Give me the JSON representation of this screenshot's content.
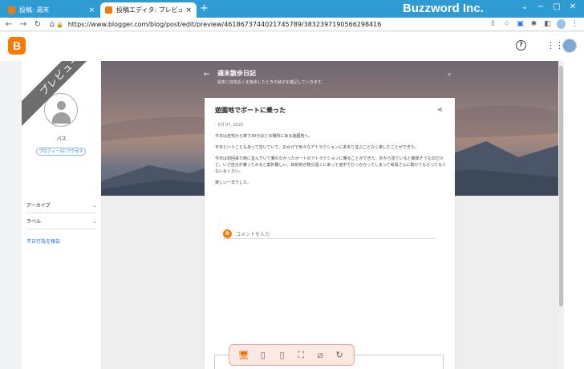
{
  "browser": {
    "tabs": [
      {
        "title": "投稿: 週末"
      },
      {
        "title": "投稿エディタ: プレビュー"
      }
    ],
    "tab_close": "×",
    "new_tab": "+",
    "brand": "Buzzword Inc.",
    "url": "https://www.blogger.com/blog/post/edit/preview/4618673744021745789/3832397190566298416",
    "window_controls": [
      "⌄",
      "−",
      "□",
      "✕"
    ],
    "nav": [
      "←",
      "→",
      "↻"
    ]
  },
  "blogger_header": {
    "logo": "B",
    "help": "?"
  },
  "sidebar": {
    "ribbon": "プレビュー",
    "profile_name": "パス",
    "profile_button": "プロフィールにアクセス",
    "items": [
      {
        "label": "アーカイブ"
      },
      {
        "label": "ラベル"
      }
    ],
    "report": "不正行為を報告"
  },
  "blog": {
    "title": "週末散歩日記",
    "subtitle": "週末に自宅近くを散歩したときの様子を雑記していきます。"
  },
  "post": {
    "title": "遊園地でボートに乗った",
    "date": "- 5月 07, 2022",
    "paragraphs": [
      "今日は自宅から車で30分ほどの場所にある遊園地へ。",
      "平日ということもあって空いていて、おかげで色々なアトラクションにあまり並ぶことなく楽しむことができた。",
      "今日は初回来た時に並んでいて乗れなかったボートのアトラクションに乗ることができた。外から見ていると簡単そうなのだけど、いざ自分が乗ってみると案外難しい。目的地が随分遠くにあって途中でひっかかってしまって係員さんに助けてもらってる人もいるくらい。",
      "楽しい一日でした。"
    ],
    "comment_placeholder": "コメントを入力"
  },
  "colors": {
    "blogger_orange": "#f57c00",
    "tab_strip": "#2f9bd3",
    "device_bar_bg": "#fde9e3"
  }
}
